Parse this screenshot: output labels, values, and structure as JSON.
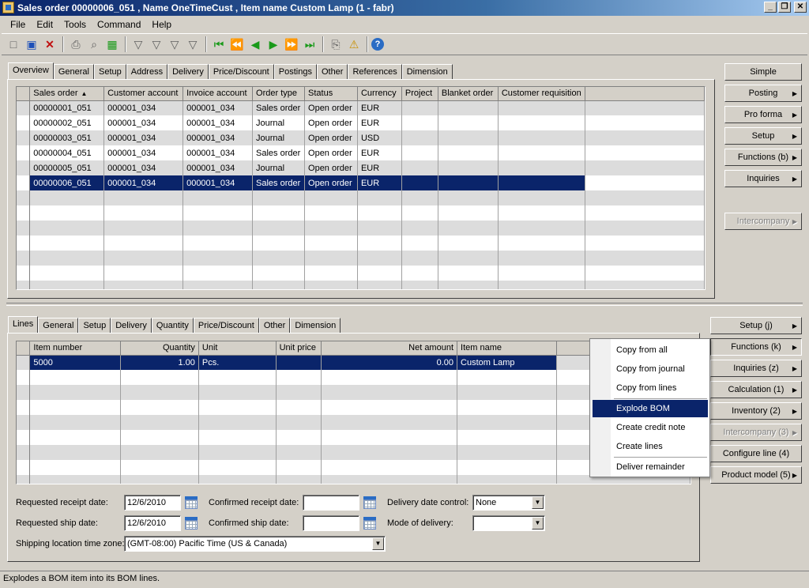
{
  "window": {
    "title": "Sales order 00000006_051 , Name OneTimeCust , Item name Custom Lamp (1 - fabr)",
    "buttons": [
      "_",
      "❒",
      "✕"
    ]
  },
  "menubar": [
    {
      "label": "File"
    },
    {
      "label": "Edit"
    },
    {
      "label": "Tools"
    },
    {
      "label": "Command"
    },
    {
      "label": "Help"
    }
  ],
  "toolbar": [
    {
      "icon": "new-icon",
      "glyph": "□"
    },
    {
      "icon": "save-icon",
      "glyph": "▣"
    },
    {
      "icon": "delete-icon",
      "glyph": "✕"
    },
    {
      "icon": "print-icon",
      "glyph": "⎙"
    },
    {
      "icon": "print-preview-icon",
      "glyph": "⌕"
    },
    {
      "icon": "excel-export-icon",
      "glyph": "▦"
    },
    {
      "icon": "filter-icon",
      "glyph": "▽"
    },
    {
      "icon": "filter-by-selection-icon",
      "glyph": "▽"
    },
    {
      "icon": "advanced-filter-icon",
      "glyph": "▽"
    },
    {
      "icon": "remove-filter-icon",
      "glyph": "▽"
    },
    {
      "icon": "first-record-icon",
      "glyph": "⏮"
    },
    {
      "icon": "previous-page-icon",
      "glyph": "⏪"
    },
    {
      "icon": "previous-record-icon",
      "glyph": "◀"
    },
    {
      "icon": "next-record-icon",
      "glyph": "▶"
    },
    {
      "icon": "next-page-icon",
      "glyph": "⏩"
    },
    {
      "icon": "last-record-icon",
      "glyph": "⏭"
    },
    {
      "icon": "document-handling-icon",
      "glyph": "⎘"
    },
    {
      "icon": "alert-icon",
      "glyph": "⚠"
    },
    {
      "icon": "help-icon",
      "glyph": "?"
    }
  ],
  "header_tabs": [
    "Overview",
    "General",
    "Setup",
    "Address",
    "Delivery",
    "Price/Discount",
    "Postings",
    "Other",
    "References",
    "Dimension"
  ],
  "orders_grid": {
    "columns": [
      "Sales order",
      "Customer account",
      "Invoice account",
      "Order type",
      "Status",
      "Currency",
      "Project",
      "Blanket order",
      "Customer requisition"
    ],
    "rows": [
      [
        "00000001_051",
        "000001_034",
        "000001_034",
        "Sales order",
        "Open order",
        "EUR",
        "",
        "",
        ""
      ],
      [
        "00000002_051",
        "000001_034",
        "000001_034",
        "Journal",
        "Open order",
        "EUR",
        "",
        "",
        ""
      ],
      [
        "00000003_051",
        "000001_034",
        "000001_034",
        "Journal",
        "Open order",
        "USD",
        "",
        "",
        ""
      ],
      [
        "00000004_051",
        "000001_034",
        "000001_034",
        "Sales order",
        "Open order",
        "EUR",
        "",
        "",
        ""
      ],
      [
        "00000005_051",
        "000001_034",
        "000001_034",
        "Journal",
        "Open order",
        "EUR",
        "",
        "",
        ""
      ],
      [
        "00000006_051",
        "000001_034",
        "000001_034",
        "Sales order",
        "Open order",
        "EUR",
        "",
        "",
        ""
      ]
    ],
    "selected_row": 5
  },
  "header_buttons": [
    {
      "label": "Simple",
      "arrow": false,
      "disabled": false
    },
    {
      "label": "Posting",
      "arrow": true,
      "disabled": false
    },
    {
      "label": "Pro forma",
      "arrow": true,
      "disabled": false
    },
    {
      "label": "Setup",
      "arrow": true,
      "disabled": false
    },
    {
      "label": "Functions (b)",
      "arrow": true,
      "disabled": false
    },
    {
      "label": "Inquiries",
      "arrow": true,
      "disabled": false
    },
    {
      "label": "Intercompany",
      "arrow": true,
      "disabled": true
    }
  ],
  "lines_tabs": [
    "Lines",
    "General",
    "Setup",
    "Delivery",
    "Quantity",
    "Price/Discount",
    "Other",
    "Dimension"
  ],
  "lines_grid": {
    "columns": [
      "Item number",
      "Quantity",
      "Unit",
      "Unit price",
      "Net amount",
      "Item name"
    ],
    "rows": [
      [
        "5000",
        "1.00",
        "Pcs.",
        "",
        "0.00",
        "Custom Lamp"
      ]
    ],
    "selected_row": 0
  },
  "lines_buttons": [
    {
      "label": "Setup (j)",
      "arrow": true,
      "disabled": false,
      "pressed": false
    },
    {
      "label": "Functions (k)",
      "arrow": true,
      "disabled": false,
      "pressed": true
    },
    {
      "label": "Inquiries (z)",
      "arrow": true,
      "disabled": false,
      "pressed": false
    },
    {
      "label": "Calculation (1)",
      "arrow": true,
      "disabled": false,
      "pressed": false
    },
    {
      "label": "Inventory (2)",
      "arrow": true,
      "disabled": false,
      "pressed": false
    },
    {
      "label": "Intercompany (3)",
      "arrow": true,
      "disabled": true,
      "pressed": false
    },
    {
      "label": "Configure line (4)",
      "arrow": false,
      "disabled": false,
      "pressed": false
    },
    {
      "label": "Product model (5)",
      "arrow": true,
      "disabled": false,
      "pressed": false
    }
  ],
  "context_menu": {
    "items": [
      "Copy from all",
      "Copy from journal",
      "Copy from lines",
      "Explode BOM",
      "Create credit note",
      "Create lines",
      "Deliver remainder"
    ],
    "highlighted": "Explode BOM"
  },
  "form": {
    "requested_receipt_date": {
      "label": "Requested receipt date:",
      "value": "12/6/2010"
    },
    "requested_ship_date": {
      "label": "Requested ship date:",
      "value": "12/6/2010"
    },
    "confirmed_receipt_date": {
      "label": "Confirmed receipt date:",
      "value": ""
    },
    "confirmed_ship_date": {
      "label": "Confirmed ship date:",
      "value": ""
    },
    "delivery_date_control": {
      "label": "Delivery date control:",
      "value": "None"
    },
    "mode_of_delivery": {
      "label": "Mode of delivery:",
      "value": ""
    },
    "shipping_tz": {
      "label": "Shipping location time zone:",
      "value": "(GMT-08:00) Pacific Time (US & Canada)"
    }
  },
  "status_text": "Explodes a BOM item into its BOM lines."
}
